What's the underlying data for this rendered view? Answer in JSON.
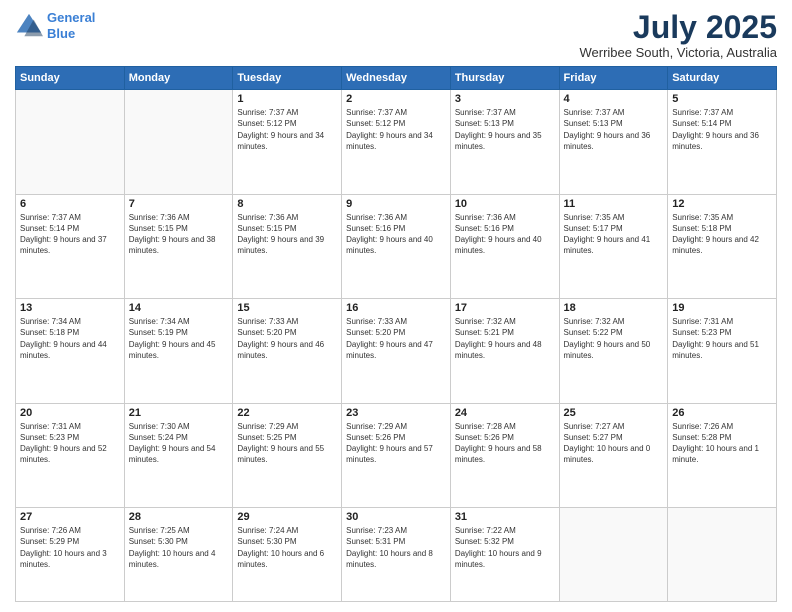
{
  "header": {
    "logo_line1": "General",
    "logo_line2": "Blue",
    "month_title": "July 2025",
    "location": "Werribee South, Victoria, Australia"
  },
  "weekdays": [
    "Sunday",
    "Monday",
    "Tuesday",
    "Wednesday",
    "Thursday",
    "Friday",
    "Saturday"
  ],
  "weeks": [
    [
      {
        "day": "",
        "sunrise": "",
        "sunset": "",
        "daylight": ""
      },
      {
        "day": "",
        "sunrise": "",
        "sunset": "",
        "daylight": ""
      },
      {
        "day": "1",
        "sunrise": "Sunrise: 7:37 AM",
        "sunset": "Sunset: 5:12 PM",
        "daylight": "Daylight: 9 hours and 34 minutes."
      },
      {
        "day": "2",
        "sunrise": "Sunrise: 7:37 AM",
        "sunset": "Sunset: 5:12 PM",
        "daylight": "Daylight: 9 hours and 34 minutes."
      },
      {
        "day": "3",
        "sunrise": "Sunrise: 7:37 AM",
        "sunset": "Sunset: 5:13 PM",
        "daylight": "Daylight: 9 hours and 35 minutes."
      },
      {
        "day": "4",
        "sunrise": "Sunrise: 7:37 AM",
        "sunset": "Sunset: 5:13 PM",
        "daylight": "Daylight: 9 hours and 36 minutes."
      },
      {
        "day": "5",
        "sunrise": "Sunrise: 7:37 AM",
        "sunset": "Sunset: 5:14 PM",
        "daylight": "Daylight: 9 hours and 36 minutes."
      }
    ],
    [
      {
        "day": "6",
        "sunrise": "Sunrise: 7:37 AM",
        "sunset": "Sunset: 5:14 PM",
        "daylight": "Daylight: 9 hours and 37 minutes."
      },
      {
        "day": "7",
        "sunrise": "Sunrise: 7:36 AM",
        "sunset": "Sunset: 5:15 PM",
        "daylight": "Daylight: 9 hours and 38 minutes."
      },
      {
        "day": "8",
        "sunrise": "Sunrise: 7:36 AM",
        "sunset": "Sunset: 5:15 PM",
        "daylight": "Daylight: 9 hours and 39 minutes."
      },
      {
        "day": "9",
        "sunrise": "Sunrise: 7:36 AM",
        "sunset": "Sunset: 5:16 PM",
        "daylight": "Daylight: 9 hours and 40 minutes."
      },
      {
        "day": "10",
        "sunrise": "Sunrise: 7:36 AM",
        "sunset": "Sunset: 5:16 PM",
        "daylight": "Daylight: 9 hours and 40 minutes."
      },
      {
        "day": "11",
        "sunrise": "Sunrise: 7:35 AM",
        "sunset": "Sunset: 5:17 PM",
        "daylight": "Daylight: 9 hours and 41 minutes."
      },
      {
        "day": "12",
        "sunrise": "Sunrise: 7:35 AM",
        "sunset": "Sunset: 5:18 PM",
        "daylight": "Daylight: 9 hours and 42 minutes."
      }
    ],
    [
      {
        "day": "13",
        "sunrise": "Sunrise: 7:34 AM",
        "sunset": "Sunset: 5:18 PM",
        "daylight": "Daylight: 9 hours and 44 minutes."
      },
      {
        "day": "14",
        "sunrise": "Sunrise: 7:34 AM",
        "sunset": "Sunset: 5:19 PM",
        "daylight": "Daylight: 9 hours and 45 minutes."
      },
      {
        "day": "15",
        "sunrise": "Sunrise: 7:33 AM",
        "sunset": "Sunset: 5:20 PM",
        "daylight": "Daylight: 9 hours and 46 minutes."
      },
      {
        "day": "16",
        "sunrise": "Sunrise: 7:33 AM",
        "sunset": "Sunset: 5:20 PM",
        "daylight": "Daylight: 9 hours and 47 minutes."
      },
      {
        "day": "17",
        "sunrise": "Sunrise: 7:32 AM",
        "sunset": "Sunset: 5:21 PM",
        "daylight": "Daylight: 9 hours and 48 minutes."
      },
      {
        "day": "18",
        "sunrise": "Sunrise: 7:32 AM",
        "sunset": "Sunset: 5:22 PM",
        "daylight": "Daylight: 9 hours and 50 minutes."
      },
      {
        "day": "19",
        "sunrise": "Sunrise: 7:31 AM",
        "sunset": "Sunset: 5:23 PM",
        "daylight": "Daylight: 9 hours and 51 minutes."
      }
    ],
    [
      {
        "day": "20",
        "sunrise": "Sunrise: 7:31 AM",
        "sunset": "Sunset: 5:23 PM",
        "daylight": "Daylight: 9 hours and 52 minutes."
      },
      {
        "day": "21",
        "sunrise": "Sunrise: 7:30 AM",
        "sunset": "Sunset: 5:24 PM",
        "daylight": "Daylight: 9 hours and 54 minutes."
      },
      {
        "day": "22",
        "sunrise": "Sunrise: 7:29 AM",
        "sunset": "Sunset: 5:25 PM",
        "daylight": "Daylight: 9 hours and 55 minutes."
      },
      {
        "day": "23",
        "sunrise": "Sunrise: 7:29 AM",
        "sunset": "Sunset: 5:26 PM",
        "daylight": "Daylight: 9 hours and 57 minutes."
      },
      {
        "day": "24",
        "sunrise": "Sunrise: 7:28 AM",
        "sunset": "Sunset: 5:26 PM",
        "daylight": "Daylight: 9 hours and 58 minutes."
      },
      {
        "day": "25",
        "sunrise": "Sunrise: 7:27 AM",
        "sunset": "Sunset: 5:27 PM",
        "daylight": "Daylight: 10 hours and 0 minutes."
      },
      {
        "day": "26",
        "sunrise": "Sunrise: 7:26 AM",
        "sunset": "Sunset: 5:28 PM",
        "daylight": "Daylight: 10 hours and 1 minute."
      }
    ],
    [
      {
        "day": "27",
        "sunrise": "Sunrise: 7:26 AM",
        "sunset": "Sunset: 5:29 PM",
        "daylight": "Daylight: 10 hours and 3 minutes."
      },
      {
        "day": "28",
        "sunrise": "Sunrise: 7:25 AM",
        "sunset": "Sunset: 5:30 PM",
        "daylight": "Daylight: 10 hours and 4 minutes."
      },
      {
        "day": "29",
        "sunrise": "Sunrise: 7:24 AM",
        "sunset": "Sunset: 5:30 PM",
        "daylight": "Daylight: 10 hours and 6 minutes."
      },
      {
        "day": "30",
        "sunrise": "Sunrise: 7:23 AM",
        "sunset": "Sunset: 5:31 PM",
        "daylight": "Daylight: 10 hours and 8 minutes."
      },
      {
        "day": "31",
        "sunrise": "Sunrise: 7:22 AM",
        "sunset": "Sunset: 5:32 PM",
        "daylight": "Daylight: 10 hours and 9 minutes."
      },
      {
        "day": "",
        "sunrise": "",
        "sunset": "",
        "daylight": ""
      },
      {
        "day": "",
        "sunrise": "",
        "sunset": "",
        "daylight": ""
      }
    ]
  ]
}
